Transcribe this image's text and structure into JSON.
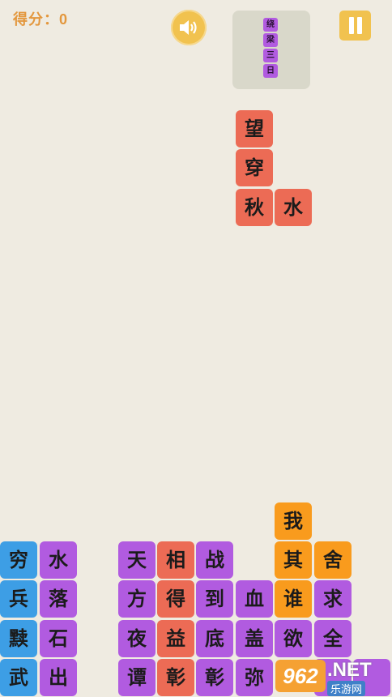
{
  "score": {
    "label": "得分：",
    "value": "0"
  },
  "colors": {
    "red": "#ec6b55",
    "purple": "#b15be0",
    "blue": "#3d9ee5",
    "orange": "#f99b1d",
    "accent": "#f1c24f"
  },
  "controls": {
    "sound_icon": "speaker-icon",
    "pause_icon": "pause-icon"
  },
  "next_piece": [
    "绕",
    "梁",
    "三",
    "日"
  ],
  "falling_piece": [
    "望",
    "穿",
    "秋",
    "水"
  ],
  "board": {
    "col1": [
      "穷",
      "兵",
      "黩",
      "武"
    ],
    "col2": [
      "水",
      "落",
      "石",
      "出"
    ],
    "col3": [
      "天",
      "方",
      "夜",
      "谭"
    ],
    "col4": [
      "相",
      "得",
      "益",
      "彰"
    ],
    "col5": [
      "战",
      "到",
      "底",
      "彰"
    ],
    "col6": [
      "血",
      "盖",
      "弥"
    ],
    "col7": [
      "我",
      "其",
      "谁",
      "欲"
    ],
    "col8": [
      "舍",
      "求",
      "全"
    ]
  },
  "watermark": {
    "badge": "962",
    "suffix": ".NET",
    "name": "乐游网"
  }
}
